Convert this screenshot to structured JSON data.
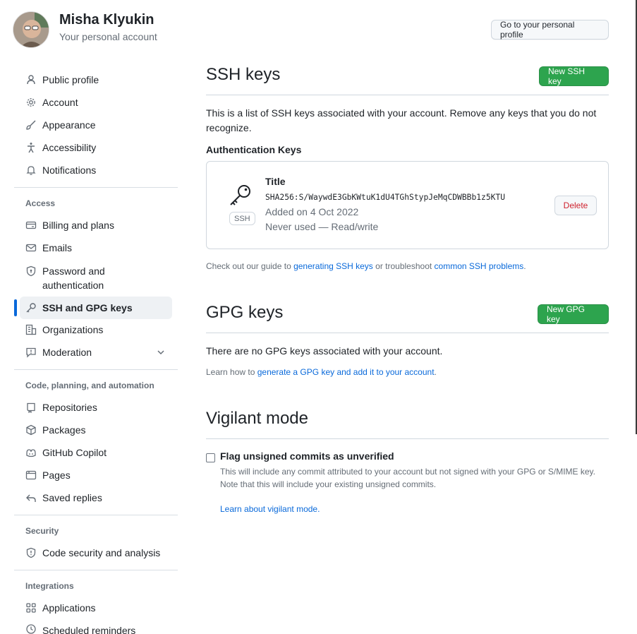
{
  "header": {
    "user_name": "Misha Klyukin",
    "user_subtitle": "Your personal account",
    "profile_button": "Go to your personal profile"
  },
  "sidebar": {
    "items": [
      {
        "label": "Public profile",
        "icon": "person-icon"
      },
      {
        "label": "Account",
        "icon": "gear-icon"
      },
      {
        "label": "Appearance",
        "icon": "paintbrush-icon"
      },
      {
        "label": "Accessibility",
        "icon": "accessibility-icon"
      },
      {
        "label": "Notifications",
        "icon": "bell-icon"
      }
    ],
    "access_heading": "Access",
    "access_items": [
      {
        "label": "Billing and plans",
        "icon": "credit-card-icon"
      },
      {
        "label": "Emails",
        "icon": "mail-icon"
      },
      {
        "label": "Password and authentication",
        "icon": "shield-lock-icon"
      },
      {
        "label": "SSH and GPG keys",
        "icon": "key-icon",
        "active": true
      },
      {
        "label": "Organizations",
        "icon": "organization-icon"
      },
      {
        "label": "Moderation",
        "icon": "report-icon",
        "expandable": true
      }
    ],
    "code_heading": "Code, planning, and automation",
    "code_items": [
      {
        "label": "Repositories",
        "icon": "repo-icon"
      },
      {
        "label": "Packages",
        "icon": "package-icon"
      },
      {
        "label": "GitHub Copilot",
        "icon": "copilot-icon"
      },
      {
        "label": "Pages",
        "icon": "browser-icon"
      },
      {
        "label": "Saved replies",
        "icon": "reply-icon"
      }
    ],
    "security_heading": "Security",
    "security_items": [
      {
        "label": "Code security and analysis",
        "icon": "shield-icon"
      }
    ],
    "integrations_heading": "Integrations",
    "integrations_items": [
      {
        "label": "Applications",
        "icon": "apps-icon"
      },
      {
        "label": "Scheduled reminders",
        "icon": "clock-icon"
      }
    ]
  },
  "ssh": {
    "title": "SSH keys",
    "new_button": "New SSH key",
    "description": "This is a list of SSH keys associated with your account. Remove any keys that you do not recognize.",
    "auth_heading": "Authentication Keys",
    "key": {
      "title": "Title",
      "fingerprint": "SHA256:S/WaywdE3GbKWtuK1dU4TGhStypJeMqCDWBBb1z5KTU",
      "added": "Added on 4 Oct 2022",
      "usage": "Never used — Read/write",
      "badge": "SSH",
      "delete_button": "Delete"
    },
    "guide_prefix": "Check out our guide to ",
    "guide_link": "generating SSH keys",
    "guide_middle": " or troubleshoot ",
    "guide_link2": "common SSH problems",
    "guide_suffix": "."
  },
  "gpg": {
    "title": "GPG keys",
    "new_button": "New GPG key",
    "empty_text": "There are no GPG keys associated with your account.",
    "learn_prefix": "Learn how to ",
    "learn_link": "generate a GPG key and add it to your account",
    "learn_suffix": "."
  },
  "vigilant": {
    "title": "Vigilant mode",
    "checkbox_label": "Flag unsigned commits as unverified",
    "checked": false,
    "note": "This will include any commit attributed to your account but not signed with your GPG or S/MIME key. Note that this will include your existing unsigned commits.",
    "learn_link": "Learn about vigilant mode."
  },
  "colors": {
    "accent": "#0969da",
    "green": "#2da44e",
    "danger": "#cf222e"
  }
}
